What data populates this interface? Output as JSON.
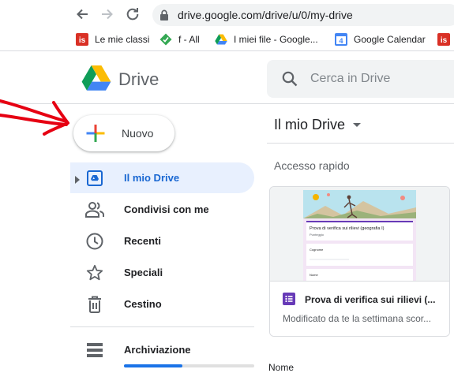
{
  "browser": {
    "url": "drive.google.com/drive/u/0/my-drive",
    "bookmarks": [
      {
        "label": "Le mie classi",
        "icon": "is-red-icon"
      },
      {
        "label": "f - All",
        "icon": "green-diamond-icon"
      },
      {
        "label": "I miei file - Google...",
        "icon": "drive-icon"
      },
      {
        "label": "Google Calendar",
        "icon": "calendar-icon",
        "badge": "4"
      },
      {
        "label": "",
        "icon": "is-red-icon"
      }
    ]
  },
  "header": {
    "brand": "Drive",
    "search_placeholder": "Cerca in Drive"
  },
  "sidebar": {
    "new_label": "Nuovo",
    "items": [
      {
        "label": "Il mio Drive",
        "icon": "my-drive-icon",
        "active": true
      },
      {
        "label": "Condivisi con me",
        "icon": "shared-people-icon",
        "active": false
      },
      {
        "label": "Recenti",
        "icon": "clock-icon",
        "active": false
      },
      {
        "label": "Speciali",
        "icon": "star-icon",
        "active": false
      },
      {
        "label": "Cestino",
        "icon": "trash-icon",
        "active": false
      }
    ],
    "storage_label": "Archiviazione",
    "storage_used_fraction": 0.45
  },
  "main": {
    "title": "Il mio Drive",
    "section_title": "Accesso rapido",
    "card": {
      "name": "Prova di verifica sui rilievi (...",
      "meta": "Modificato da te la settimana scor...",
      "thumb_title": "Prova di verifica sui rilievi (geografia I)",
      "thumb_subtitle": "Punteggio",
      "thumb_field1": "Cognome",
      "thumb_field2": "Nome"
    },
    "column_name": "Nome"
  },
  "colors": {
    "accent_blue": "#1a73e8",
    "active_bg": "#e8f0fe",
    "forms_purple": "#673ab7",
    "annotation_red": "#e60012"
  }
}
